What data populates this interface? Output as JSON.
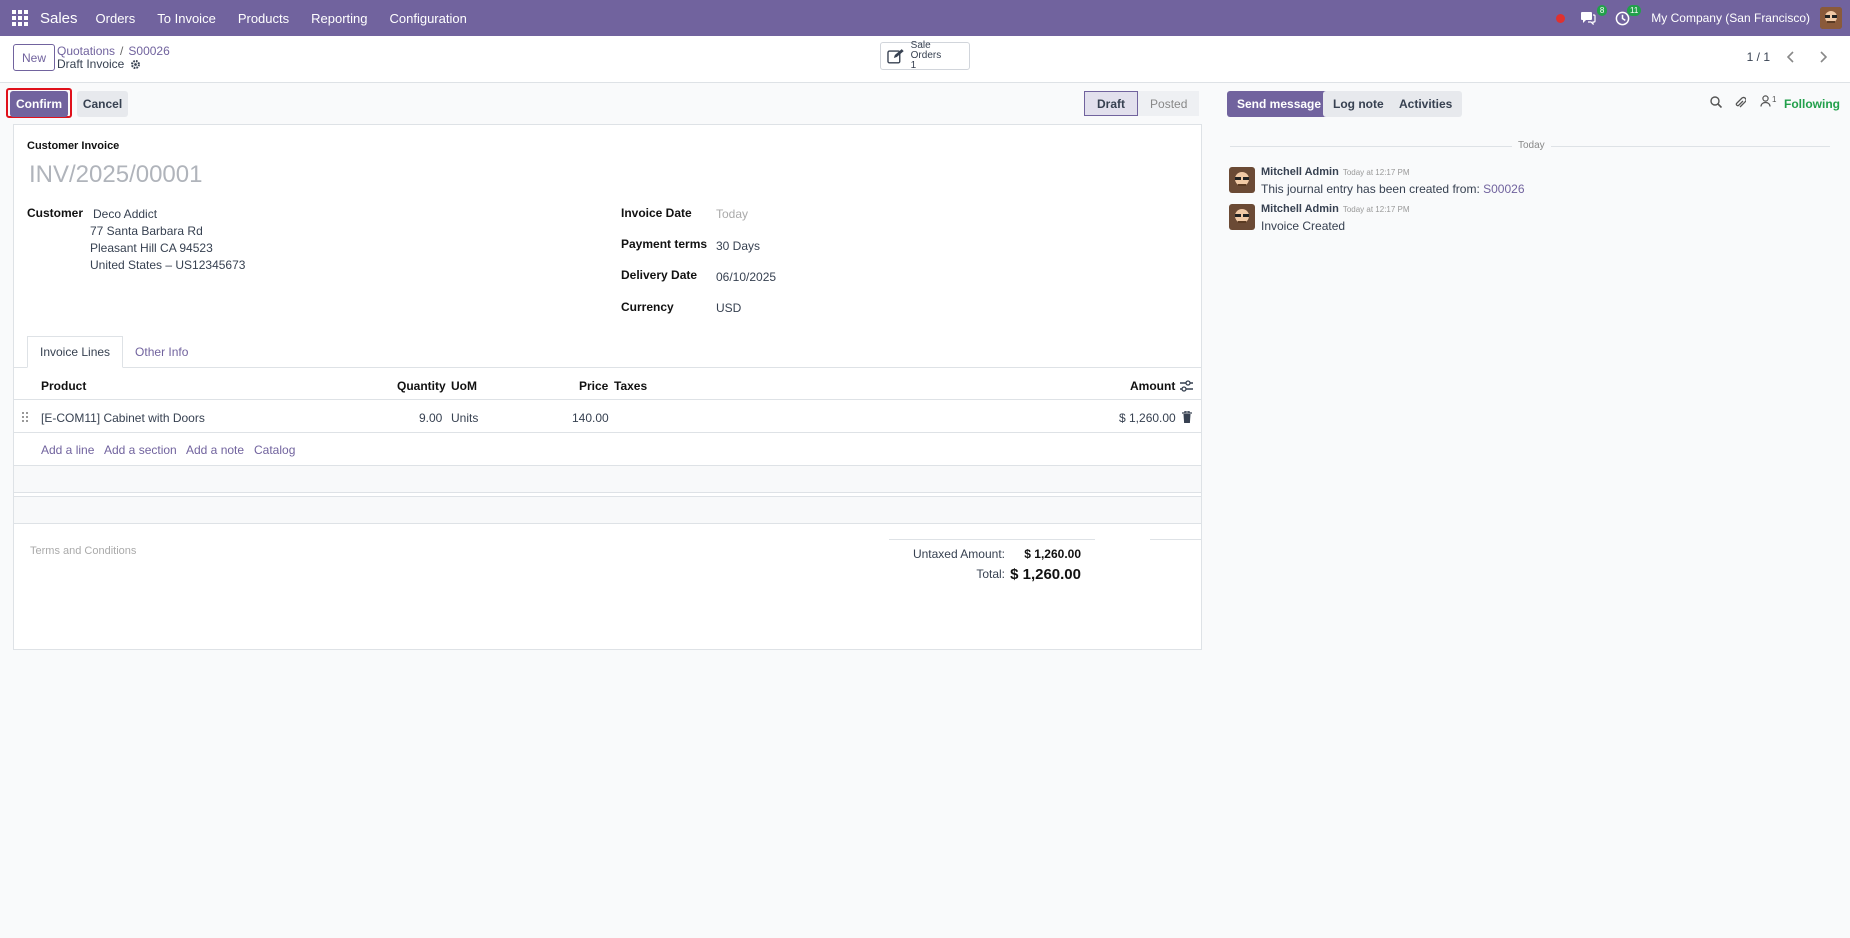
{
  "navbar": {
    "app_name": "Sales",
    "menu": [
      "Orders",
      "To Invoice",
      "Products",
      "Reporting",
      "Configuration"
    ],
    "messages_count": "8",
    "activities_count": "11",
    "company": "My Company (San Francisco)"
  },
  "control_panel": {
    "new_label": "New",
    "breadcrumb": [
      "Quotations",
      "S00026"
    ],
    "record_title": "Draft Invoice",
    "smart_button": {
      "label": "Sale Orders",
      "count": "1"
    },
    "pager": "1 / 1"
  },
  "actions": {
    "confirm": "Confirm",
    "cancel": "Cancel"
  },
  "statusbar": {
    "stages": [
      "Draft",
      "Posted"
    ],
    "active": "Draft"
  },
  "form": {
    "type_label": "Customer Invoice",
    "number": "INV/2025/00001",
    "customer_label": "Customer",
    "customer_name": "Deco Addict",
    "address": [
      "77 Santa Barbara Rd",
      "Pleasant Hill CA 94523",
      "United States – US12345673"
    ],
    "invoice_date_label": "Invoice Date",
    "invoice_date_value": "Today",
    "payment_terms_label": "Payment terms",
    "payment_terms_value": "30 Days",
    "delivery_date_label": "Delivery Date",
    "delivery_date_value": "06/10/2025",
    "currency_label": "Currency",
    "currency_value": "USD"
  },
  "tabs": [
    "Invoice Lines",
    "Other Info"
  ],
  "lines": {
    "headers": [
      "Product",
      "Quantity",
      "UoM",
      "Price",
      "Taxes",
      "Amount"
    ],
    "rows": [
      {
        "product": "[E-COM11] Cabinet with Doors",
        "quantity": "9.00",
        "uom": "Units",
        "price": "140.00",
        "taxes": "",
        "amount": "$ 1,260.00"
      }
    ],
    "add_links": [
      "Add a line",
      "Add a section",
      "Add a note",
      "Catalog"
    ]
  },
  "terms_placeholder": "Terms and Conditions",
  "totals": {
    "untaxed_label": "Untaxed Amount:",
    "untaxed_value": "$ 1,260.00",
    "total_label": "Total:",
    "total_value": "$ 1,260.00"
  },
  "chatter": {
    "send_message": "Send message",
    "log_note": "Log note",
    "activities": "Activities",
    "followers_count": "1",
    "following": "Following",
    "date_separator": "Today",
    "messages": [
      {
        "author": "Mitchell Admin",
        "time": "Today at 12:17 PM",
        "body": "This journal entry has been created from: ",
        "link": "S00026"
      },
      {
        "author": "Mitchell Admin",
        "time": "Today at 12:17 PM",
        "body": "Invoice Created",
        "link": ""
      }
    ]
  },
  "colors": {
    "brand": "#71639e",
    "success": "#22a04b",
    "danger": "#e0111b"
  }
}
